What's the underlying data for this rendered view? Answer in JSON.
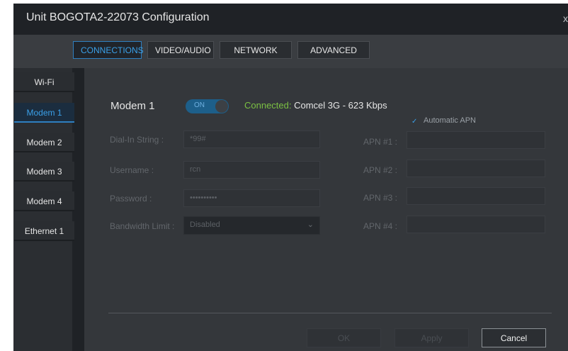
{
  "window": {
    "title": "Unit BOGOTA2-22073 Configuration",
    "close_label": "x"
  },
  "tabs": [
    {
      "label": "CONNECTIONS"
    },
    {
      "label": "VIDEO/AUDIO"
    },
    {
      "label": "NETWORK"
    },
    {
      "label": "ADVANCED"
    }
  ],
  "sidebar": {
    "items": [
      {
        "label": "Wi-Fi"
      },
      {
        "label": "Modem 1"
      },
      {
        "label": "Modem 2"
      },
      {
        "label": "Modem 3"
      },
      {
        "label": "Modem 4"
      },
      {
        "label": "Ethernet 1"
      }
    ]
  },
  "modem": {
    "title": "Modem 1",
    "toggle_label": "ON",
    "status_prefix": "Connected:",
    "status_detail": " Comcel 3G - 623 Kbps",
    "auto_apn_label": "Automatic APN",
    "fields": {
      "dialin_label": "Dial-In String :",
      "dialin_value": "*99#",
      "username_label": "Username :",
      "username_value": "rcn",
      "password_label": "Password :",
      "password_value": "••••••••••",
      "bandwidth_label": "Bandwidth Limit :",
      "bandwidth_value": "Disabled"
    },
    "apn": [
      {
        "label": "APN #1 :",
        "value": ""
      },
      {
        "label": "APN #2 :",
        "value": ""
      },
      {
        "label": "APN #3 :",
        "value": ""
      },
      {
        "label": "APN #4 :",
        "value": ""
      }
    ]
  },
  "footer": {
    "ok_label": "OK",
    "apply_label": "Apply",
    "cancel_label": "Cancel"
  }
}
